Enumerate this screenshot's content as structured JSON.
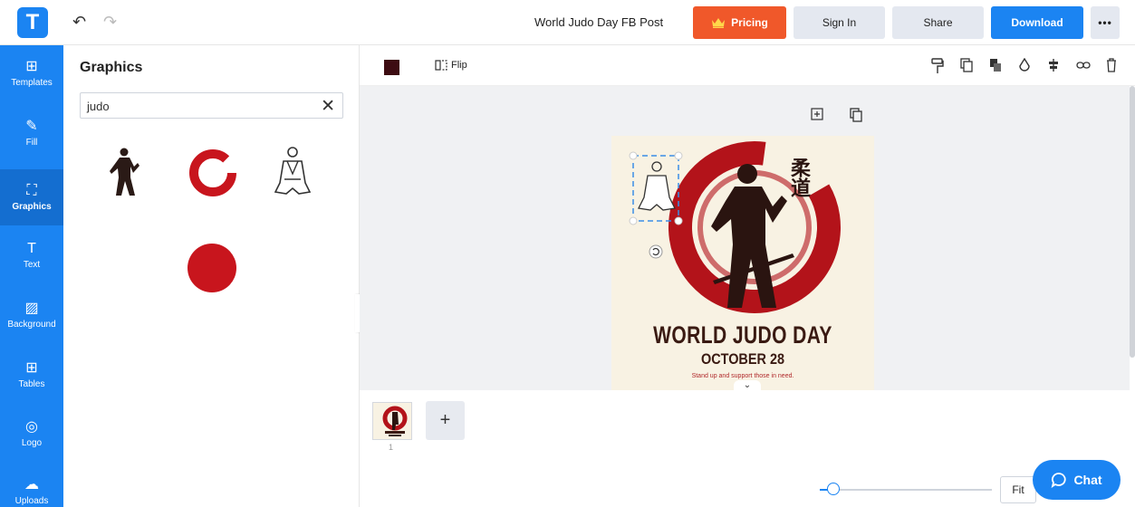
{
  "header": {
    "logo_letter": "T",
    "undo_icon": "↶",
    "redo_icon": "↷",
    "document_title": "World Judo Day FB Post",
    "pricing_label": "Pricing",
    "sign_in_label": "Sign In",
    "share_label": "Share",
    "download_label": "Download",
    "more_label": "•••"
  },
  "sidebar": {
    "items": [
      {
        "label": "Templates",
        "icon": "⊞"
      },
      {
        "label": "Fill",
        "icon": "✎"
      },
      {
        "label": "Graphics",
        "icon": "⛶"
      },
      {
        "label": "Text",
        "icon": "T"
      },
      {
        "label": "Background",
        "icon": "▨"
      },
      {
        "label": "Tables",
        "icon": "⊞"
      },
      {
        "label": "Logo",
        "icon": "◎"
      },
      {
        "label": "Uploads",
        "icon": "☁"
      }
    ]
  },
  "panel": {
    "title": "Graphics",
    "search_value": "judo",
    "clear_icon": "✕",
    "collapse_icon": "‹"
  },
  "toolbar": {
    "swatch_color": "#3d0c12",
    "flip_label": "Flip"
  },
  "design": {
    "title": "WORLD JUDO DAY",
    "date": "OCTOBER 28",
    "tagline": "Stand up and support those in need.",
    "kanji": "柔道",
    "accent_color": "#b3131a"
  },
  "pages": {
    "add_label": "+",
    "page_number": "1"
  },
  "zoom": {
    "fit_label": "Fit",
    "level_fraction": 0.08
  },
  "chat": {
    "label": "Chat"
  }
}
